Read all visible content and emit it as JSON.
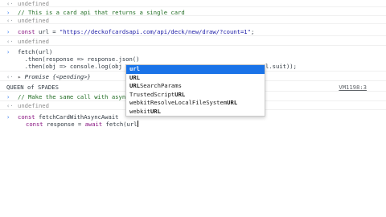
{
  "console": {
    "undefined_1": "undefined",
    "comment_1": "// This is a card api that returns a single card",
    "undefined_2": "undefined",
    "url_kw": "const",
    "url_name": " url = ",
    "url_value": "\"https://deckofcardsapi.com/api/deck/new/draw/?count=1\"",
    "url_end": ";",
    "undefined_3": "undefined",
    "fetch_1": "fetch(url)",
    "fetch_2": "  .then(response => response.json()",
    "fetch_3_start": "  .then(obj => console.log(obj",
    "fetch_3_end": "l.suit));",
    "promise_label": "Promise",
    "promise_state": "{<pending>}",
    "queen_output": "QUEEN of SPADES",
    "vm_link": "VM1198:3",
    "comment_2": "// Make the same call with asyn",
    "undefined_4": "undefined",
    "async_kw": "const",
    "async_line_1": " fetchCardWithAsyncAwait",
    "async_kw2": "const",
    "async_line_2_mid": " response = ",
    "async_kw3": "await",
    "async_line_2_end": " fetch(url"
  },
  "autocomplete": {
    "items": [
      {
        "match": "url",
        "rest": ""
      },
      {
        "match": "URL",
        "rest": ""
      },
      {
        "match": "URL",
        "rest": "SearchParams"
      },
      {
        "pre": "TrustedScript",
        "match": "URL",
        "rest": ""
      },
      {
        "pre": "webkitResolveLocalFileSystem",
        "match": "URL",
        "rest": ""
      },
      {
        "pre": "webkit",
        "match": "URL",
        "rest": ""
      }
    ]
  }
}
